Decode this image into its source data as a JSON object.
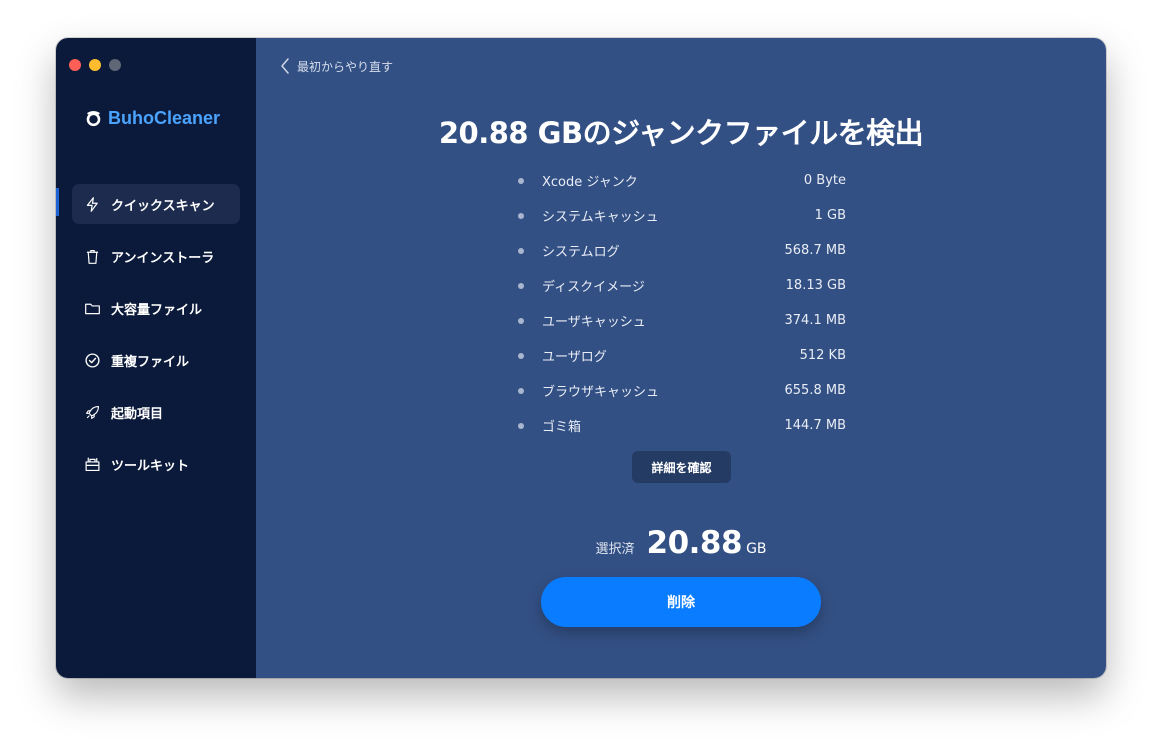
{
  "app": {
    "name": "BuhoCleaner"
  },
  "sidebar": {
    "items": [
      {
        "label": "クイックスキャン",
        "icon": "lightning-icon",
        "active": true
      },
      {
        "label": "アンインストーラ",
        "icon": "trash-icon"
      },
      {
        "label": "大容量ファイル",
        "icon": "folder-icon"
      },
      {
        "label": "重複ファイル",
        "icon": "check-circle-icon"
      },
      {
        "label": "起動項目",
        "icon": "rocket-icon"
      },
      {
        "label": "ツールキット",
        "icon": "toolbox-icon"
      }
    ]
  },
  "main": {
    "back_label": "最初からやり直す",
    "headline": "20.88 GBのジャンクファイルを検出",
    "junk_items": [
      {
        "name": "Xcode ジャンク",
        "size": "0 Byte"
      },
      {
        "name": "システムキャッシュ",
        "size": "1 GB"
      },
      {
        "name": "システムログ",
        "size": "568.7 MB"
      },
      {
        "name": "ディスクイメージ",
        "size": "18.13 GB"
      },
      {
        "name": "ユーザキャッシュ",
        "size": "374.1 MB"
      },
      {
        "name": "ユーザログ",
        "size": "512 KB"
      },
      {
        "name": "ブラウザキャッシュ",
        "size": "655.8 MB"
      },
      {
        "name": "ゴミ箱",
        "size": "144.7 MB"
      }
    ],
    "details_button": "詳細を確認",
    "selected_label": "選択済",
    "selected_value": "20.88",
    "selected_unit": "GB",
    "delete_button": "削除"
  },
  "colors": {
    "sidebar_bg": "#0b1a3a",
    "main_bg": "#335084",
    "accent": "#0a7cff",
    "logo": "#4aa3ff"
  }
}
